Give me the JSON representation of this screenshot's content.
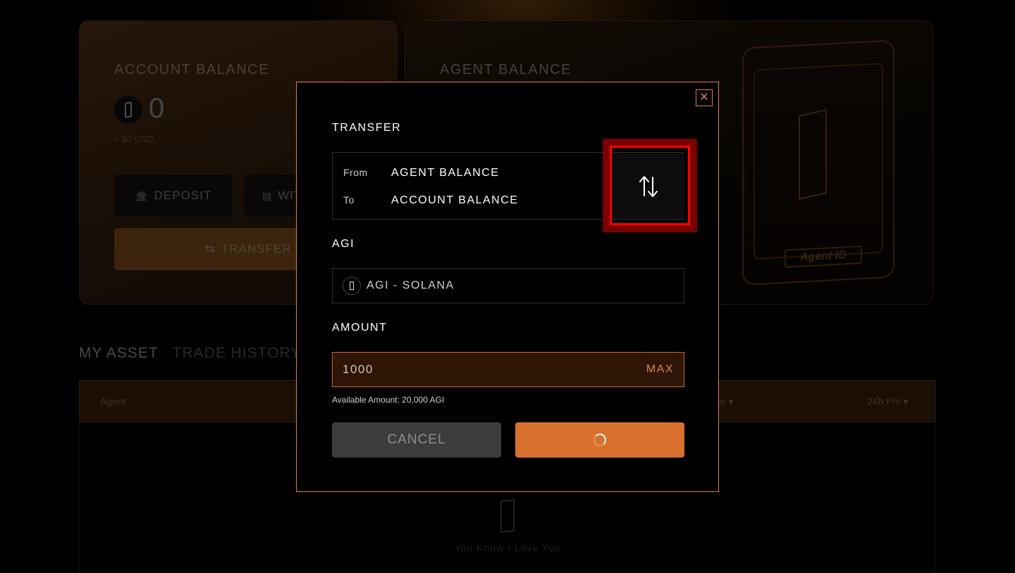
{
  "account_card": {
    "title": "ACCOUNT BALANCE",
    "balance": "0",
    "usd": "≈ $0 USD",
    "deposit_label": "DEPOSIT",
    "withdraw_label": "WIT",
    "transfer_label": "TRANSFER"
  },
  "agent_card": {
    "title": "AGENT BALANCE",
    "nft_label": "Agent ID"
  },
  "tabs": [
    {
      "label": "MY ASSET",
      "active": true
    },
    {
      "label": "TRADE HISTORY",
      "active": false
    }
  ],
  "table": {
    "headers": [
      "Agent",
      "rice",
      "24h Pnl"
    ],
    "empty_text": "You Know I Love You"
  },
  "modal": {
    "title": "TRANSFER",
    "from_label": "From",
    "from_value": "AGENT BALANCE",
    "to_label": "To",
    "to_value": "ACCOUNT BALANCE",
    "token_section": "AGI",
    "token_value": "AGI - SOLANA",
    "amount_section": "AMOUNT",
    "amount_value": "1000",
    "max_label": "MAX",
    "available_text": "Available Amount: 20,000 AGI",
    "cancel_label": "CANCEL",
    "confirm_state": "loading"
  },
  "colors": {
    "accent": "#d8702e",
    "accent_border": "#e0804a",
    "highlight": "#ff0000"
  },
  "icons": {
    "close": "close-icon",
    "swap": "swap-arrows-icon",
    "spinner": "loading-spinner-icon"
  }
}
